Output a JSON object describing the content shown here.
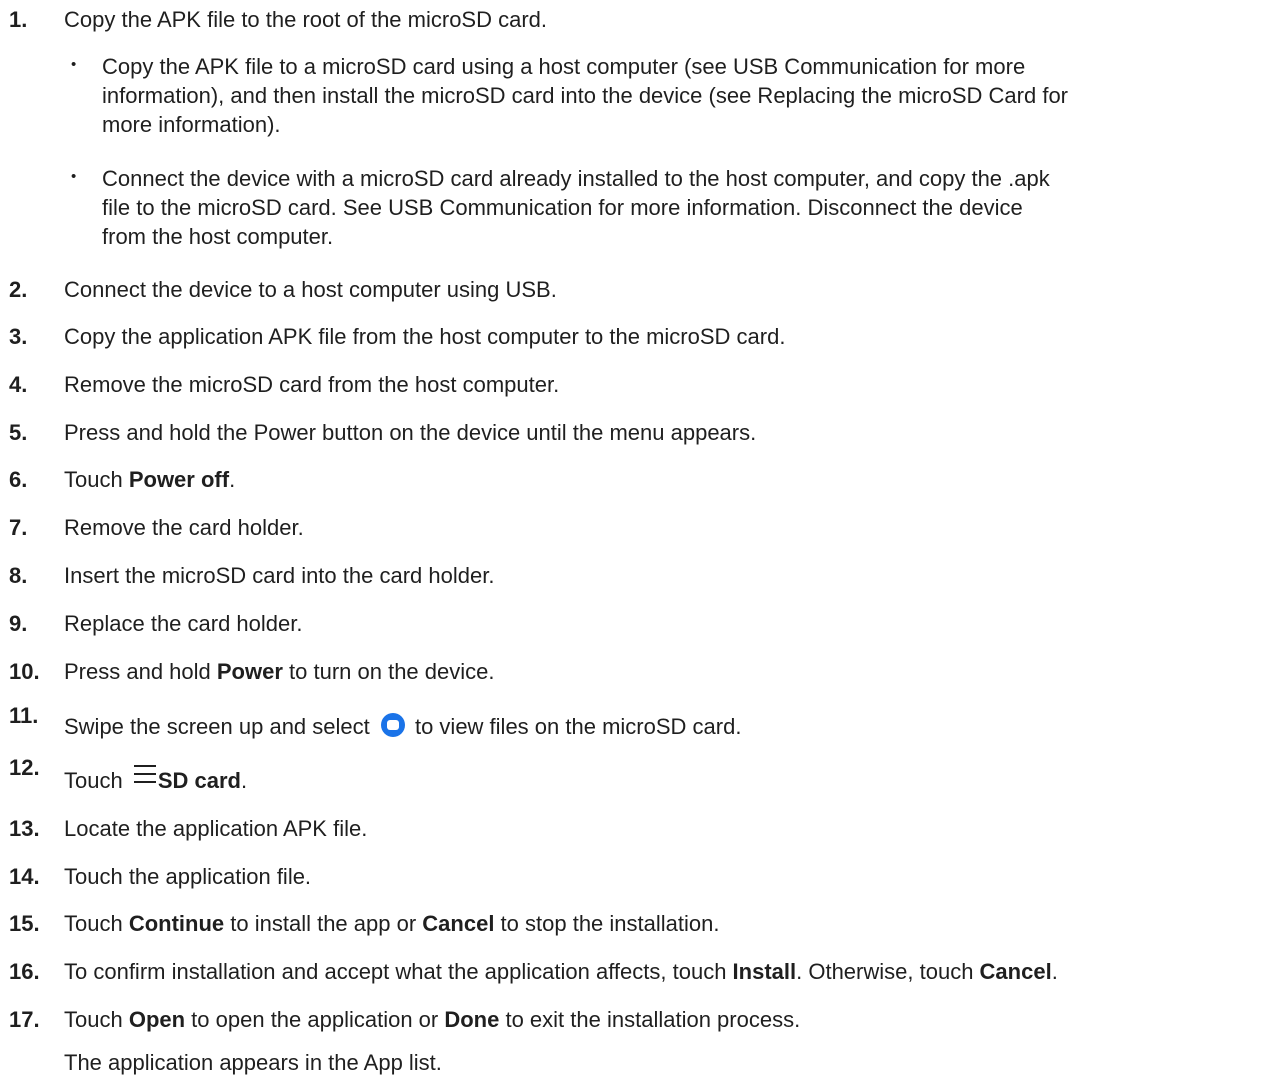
{
  "steps": [
    {
      "num": "1.",
      "text": "Copy the APK file to the root of the microSD card."
    },
    {
      "num": "2.",
      "text": "Connect the device to a host computer using USB."
    },
    {
      "num": "3.",
      "text": "Copy the application APK file from the host computer to the microSD card."
    },
    {
      "num": "4.",
      "text": "Remove the microSD card from the host computer."
    },
    {
      "num": "5.",
      "text": "Press and hold the Power button on the device until the menu appears."
    },
    {
      "num": "6.",
      "pre": "Touch ",
      "bold": "Power off",
      "post": "."
    },
    {
      "num": "7.",
      "text": "Remove the card holder."
    },
    {
      "num": "8.",
      "text": "Insert the microSD card into the card holder."
    },
    {
      "num": "9.",
      "text": "Replace the card holder."
    },
    {
      "num": "10.",
      "pre": "Press and hold ",
      "bold": "Power",
      "post": " to turn on the device."
    },
    {
      "num": "11.",
      "pre": "Swipe the screen up and select ",
      "post": " to view files on the microSD card.",
      "icon": "files-app-icon"
    },
    {
      "num": "12.",
      "pre": "Touch ",
      "bold": "SD card",
      "post": ".",
      "icon": "menu-icon"
    },
    {
      "num": "13.",
      "text": "Locate the application APK file."
    },
    {
      "num": "14.",
      "text": "Touch the application file."
    },
    {
      "num": "15.",
      "pre": "Touch ",
      "bold": "Continue",
      "mid": " to install the app or ",
      "bold2": "Cancel",
      "post": " to stop the installation."
    },
    {
      "num": "16.",
      "pre": "To confirm installation and accept what the application affects, touch ",
      "bold": "Install",
      "mid": ". Otherwise, touch ",
      "bold2": "Cancel",
      "post": "."
    },
    {
      "num": "17.",
      "pre": "Touch ",
      "bold": "Open",
      "mid": " to open the application or ",
      "bold2": "Done",
      "post": " to exit the installation process.",
      "result": "The application appears in the App list."
    }
  ],
  "substeps": [
    {
      "bullet": "•",
      "lines": [
        "Copy the APK file to a microSD card using a host computer (see USB Communication for more",
        "information), and then install the microSD card into the device (see Replacing the microSD Card for",
        "more information)."
      ]
    },
    {
      "bullet": "•",
      "lines": [
        "Connect the device with a microSD card already installed to the host computer, and copy the .apk",
        "file to the microSD card. See USB Communication for more information. Disconnect the device",
        "from the host computer."
      ]
    }
  ]
}
